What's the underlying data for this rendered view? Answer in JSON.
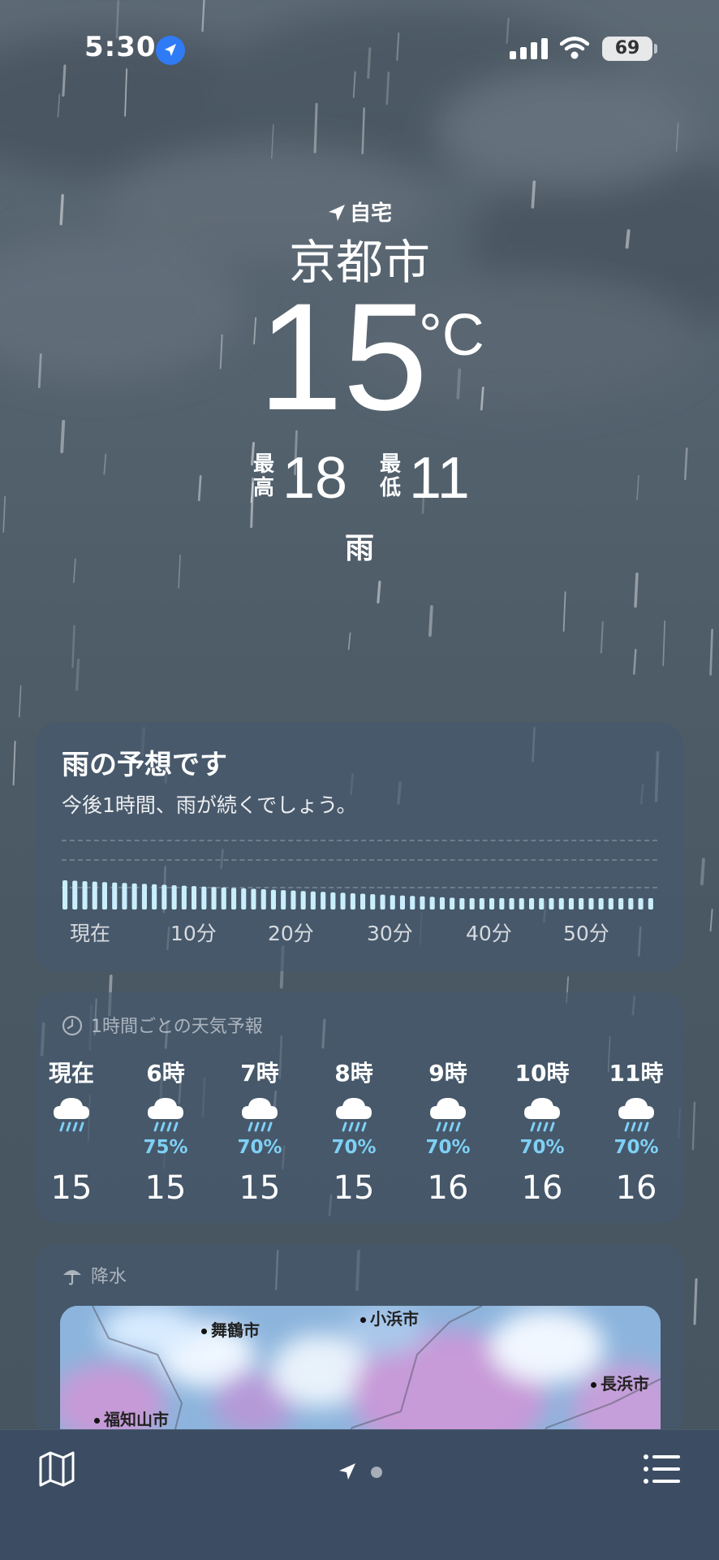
{
  "status_bar": {
    "time": "5:30",
    "battery": "69"
  },
  "header": {
    "home_label": "自宅",
    "city": "京都市",
    "temperature": "15",
    "unit": "°C",
    "high_label": "最高",
    "high": "18",
    "low_label": "最低",
    "low": "11",
    "condition": "雨"
  },
  "rain_card": {
    "title": "雨の予想です",
    "subtitle": "今後1時間、雨が続くでしょう。",
    "ticks": [
      "現在",
      "10分",
      "20分",
      "30分",
      "40分",
      "50分"
    ],
    "bar_color": "#c9eefd"
  },
  "hourly_card": {
    "header": "1時間ごとの天気予報",
    "hours": [
      {
        "label": "現在",
        "icon": "rain-cloud-icon",
        "precip": "",
        "temp": "15"
      },
      {
        "label": "6時",
        "icon": "rain-cloud-icon",
        "precip": "75%",
        "temp": "15"
      },
      {
        "label": "7時",
        "icon": "rain-cloud-icon",
        "precip": "70%",
        "temp": "15"
      },
      {
        "label": "8時",
        "icon": "rain-cloud-icon",
        "precip": "70%",
        "temp": "15"
      },
      {
        "label": "9時",
        "icon": "rain-cloud-icon",
        "precip": "70%",
        "temp": "16"
      },
      {
        "label": "10時",
        "icon": "rain-cloud-icon",
        "precip": "70%",
        "temp": "16"
      },
      {
        "label": "11時",
        "icon": "rain-cloud-icon",
        "precip": "70%",
        "temp": "16"
      }
    ],
    "precip_color": "#7fd0f5"
  },
  "precip_card": {
    "header": "降水",
    "places": [
      "舞鶴市",
      "小浜市",
      "長浜市",
      "福知山市"
    ]
  }
}
